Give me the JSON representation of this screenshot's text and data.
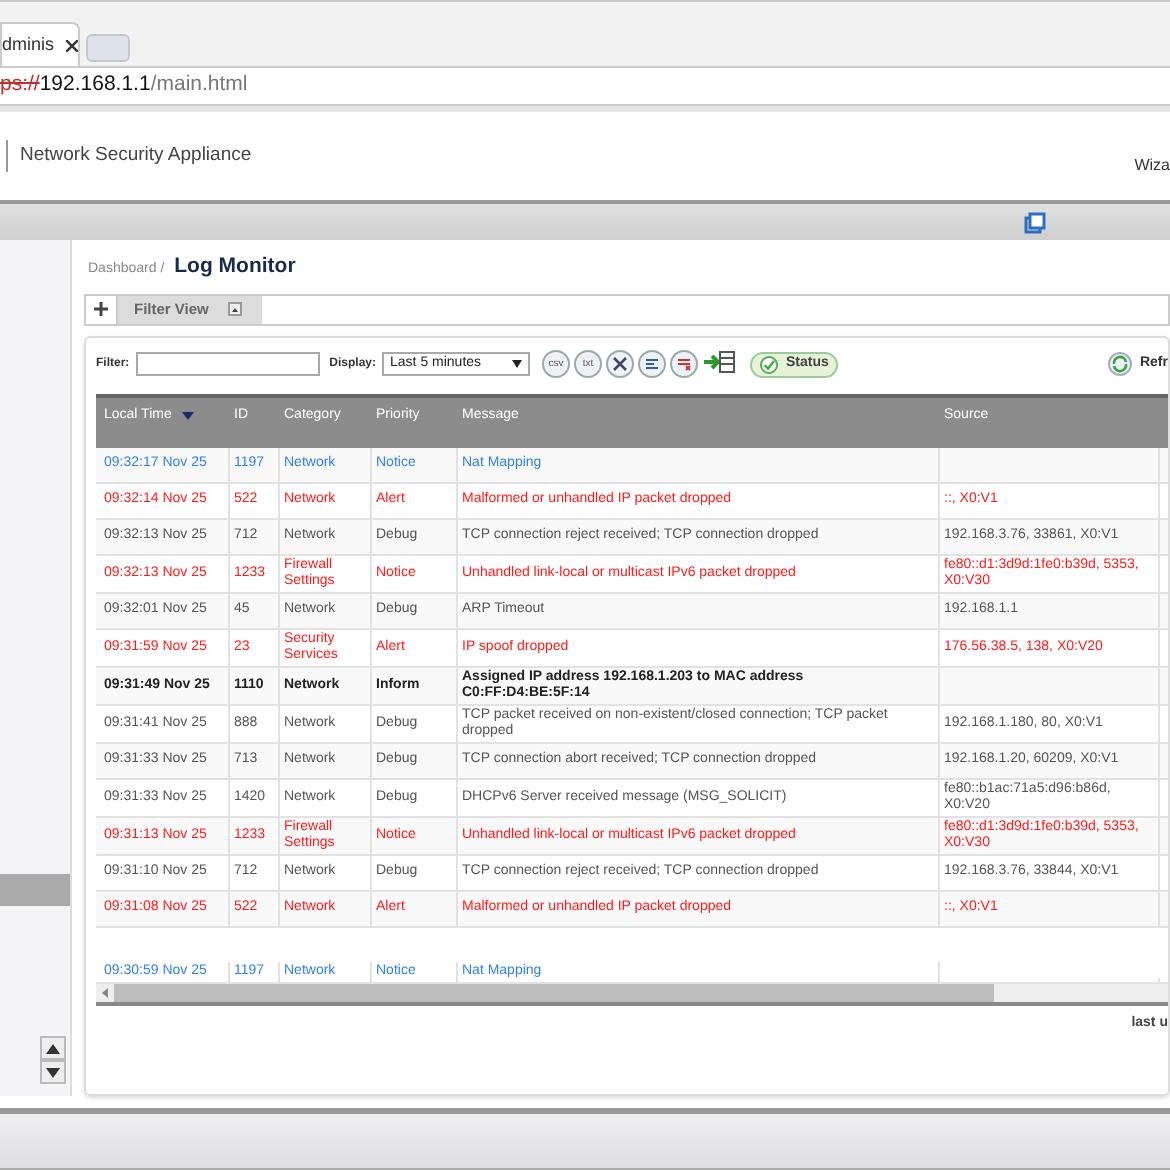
{
  "browser": {
    "tab": "dminis",
    "url_scheme": "ps://",
    "url_host": "192.168.1.1",
    "url_path": "/main.html"
  },
  "header": {
    "title": "Network Security Appliance",
    "menu": "Wiza"
  },
  "breadcrumb": {
    "parent": "Dashboard /",
    "title": "Log Monitor"
  },
  "views": [
    {
      "label": "Filter View",
      "selected": true
    }
  ],
  "toolbar": {
    "filter_label": "Filter:",
    "display_label": "Display:",
    "display_value": "Last 5 minutes",
    "export_buttons": [
      "csv",
      "txt"
    ],
    "status": "Status",
    "refresh": "Refr"
  },
  "table": {
    "columns": [
      "Local Time",
      "ID",
      "Category",
      "Priority",
      "Message",
      "Source"
    ],
    "rows": [
      {
        "kind": "notice",
        "cells": [
          "09:32:17 Nov 25",
          "1197",
          "Network",
          "Notice",
          "Nat Mapping",
          ""
        ]
      },
      {
        "kind": "alert",
        "cells": [
          "09:32:14 Nov 25",
          "522",
          "Network",
          "Alert",
          "Malformed or unhandled IP packet dropped",
          "::, X0:V1"
        ]
      },
      {
        "kind": "debug",
        "cells": [
          "09:32:13 Nov 25",
          "712",
          "Network",
          "Debug",
          "TCP connection reject received; TCP connection dropped",
          "192.168.3.76, 33861, X0:V1"
        ]
      },
      {
        "kind": "alert",
        "cells": [
          "09:32:13 Nov 25",
          "1233",
          "Firewall Settings",
          "Notice",
          "Unhandled link-local or multicast IPv6 packet dropped",
          "fe80::d1:3d9d:1fe0:b39d, 5353, X0:V30"
        ]
      },
      {
        "kind": "debug",
        "cells": [
          "09:32:01 Nov 25",
          "45",
          "Network",
          "Debug",
          "ARP Timeout",
          "192.168.1.1"
        ]
      },
      {
        "kind": "alert",
        "cells": [
          "09:31:59 Nov 25",
          "23",
          "Security Services",
          "Alert",
          "IP spoof dropped",
          "176.56.38.5, 138, X0:V20"
        ]
      },
      {
        "kind": "inform",
        "cells": [
          "09:31:49 Nov 25",
          "1110",
          "Network",
          "Inform",
          "Assigned IP address 192.168.1.203 to MAC address C0:FF:D4:BE:5F:14",
          ""
        ]
      },
      {
        "kind": "debug",
        "cells": [
          "09:31:41 Nov 25",
          "888",
          "Network",
          "Debug",
          "TCP packet received on non-existent/closed connection; TCP packet dropped",
          "192.168.1.180, 80, X0:V1"
        ]
      },
      {
        "kind": "debug",
        "cells": [
          "09:31:33 Nov 25",
          "713",
          "Network",
          "Debug",
          "TCP connection abort received; TCP connection dropped",
          "192.168.1.20, 60209, X0:V1"
        ]
      },
      {
        "kind": "debug",
        "cells": [
          "09:31:33 Nov 25",
          "1420",
          "Network",
          "Debug",
          "DHCPv6 Server received message (MSG_SOLICIT)",
          "fe80::b1ac:71a5:d96:b86d, X0:V20"
        ]
      },
      {
        "kind": "alert",
        "cells": [
          "09:31:13 Nov 25",
          "1233",
          "Firewall Settings",
          "Notice",
          "Unhandled link-local or multicast IPv6 packet dropped",
          "fe80::d1:3d9d:1fe0:b39d, 5353, X0:V30"
        ]
      },
      {
        "kind": "debug",
        "cells": [
          "09:31:10 Nov 25",
          "712",
          "Network",
          "Debug",
          "TCP connection reject received; TCP connection dropped",
          "192.168.3.76, 33844, X0:V1"
        ]
      },
      {
        "kind": "alert",
        "cells": [
          "09:31:08 Nov 25",
          "522",
          "Network",
          "Alert",
          "Malformed or unhandled IP packet dropped",
          "::, X0:V1"
        ]
      },
      {
        "kind": "notice",
        "cells": [
          "09:30:59 Nov 25",
          "1197",
          "Network",
          "Notice",
          "Nat Mapping",
          ""
        ]
      }
    ]
  },
  "footer": "last u",
  "sidebar": {
    "items": [
      {
        "selected": true
      }
    ]
  }
}
